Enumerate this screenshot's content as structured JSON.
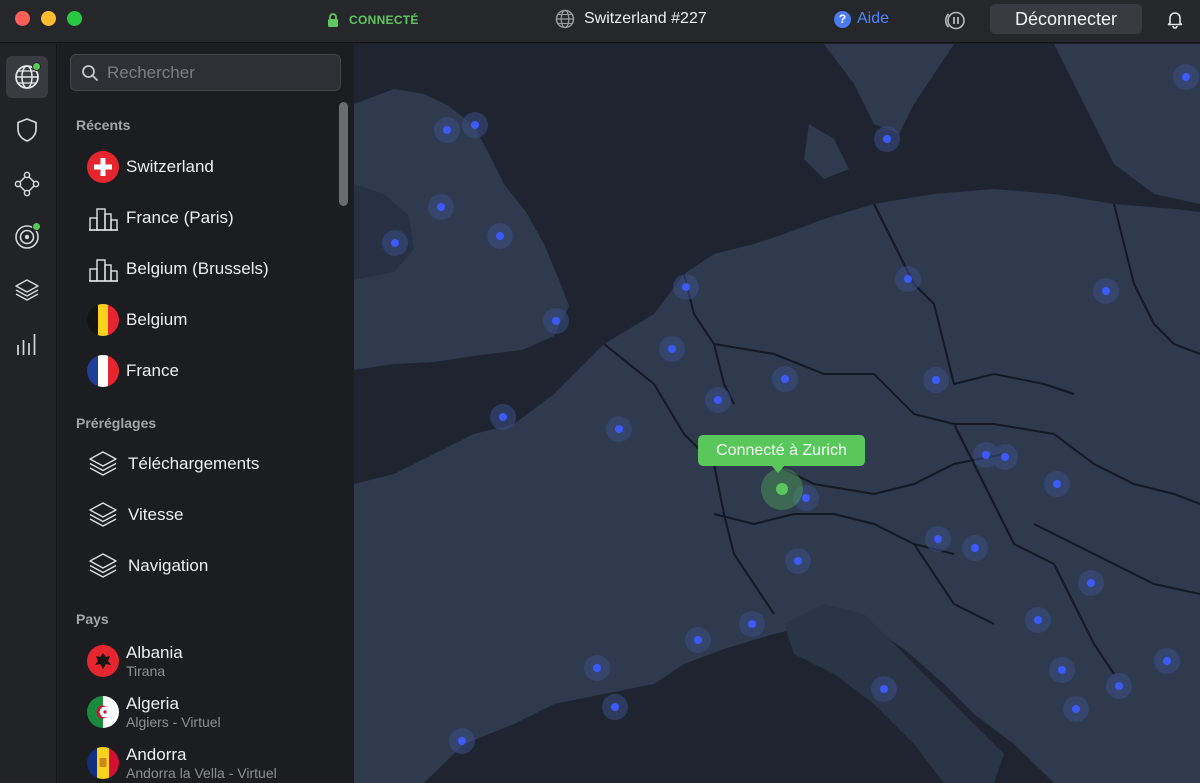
{
  "titlebar": {
    "status": "CONNECTÉ",
    "server": "Switzerland #227",
    "help_label": "Aide",
    "help_glyph": "?",
    "disconnect_label": "Déconnecter"
  },
  "search": {
    "placeholder": "Rechercher"
  },
  "recents": {
    "title": "Récents",
    "items": [
      {
        "label": "Switzerland",
        "icon": "flag-switzerland"
      },
      {
        "label": "France (Paris)",
        "icon": "city-icon"
      },
      {
        "label": "Belgium (Brussels)",
        "icon": "city-icon"
      },
      {
        "label": "Belgium",
        "icon": "flag-belgium"
      },
      {
        "label": "France",
        "icon": "flag-france"
      }
    ]
  },
  "presets": {
    "title": "Préréglages",
    "items": [
      {
        "label": "Téléchargements",
        "icon": "layers-icon"
      },
      {
        "label": "Vitesse",
        "icon": "layers-icon"
      },
      {
        "label": "Navigation",
        "icon": "layers-icon"
      }
    ]
  },
  "countries": {
    "title": "Pays",
    "items": [
      {
        "label": "Albania",
        "sub": "Tirana",
        "icon": "flag-albania"
      },
      {
        "label": "Algeria",
        "sub": "Algiers - Virtuel",
        "icon": "flag-algeria"
      },
      {
        "label": "Andorra",
        "sub": "Andorra la Vella - Virtuel",
        "icon": "flag-andorra"
      }
    ]
  },
  "rail": [
    "globe-icon",
    "shield-icon",
    "mesh-network-icon",
    "radar-icon",
    "layers-icon",
    "bar-chart-icon"
  ],
  "map": {
    "tooltip": "Connecté à Zurich"
  },
  "colors": {
    "accent_green": "#5ac75d",
    "server_dot": "#3b5bff",
    "map_land": "#2f3a4e",
    "map_sea": "#1f2431"
  }
}
